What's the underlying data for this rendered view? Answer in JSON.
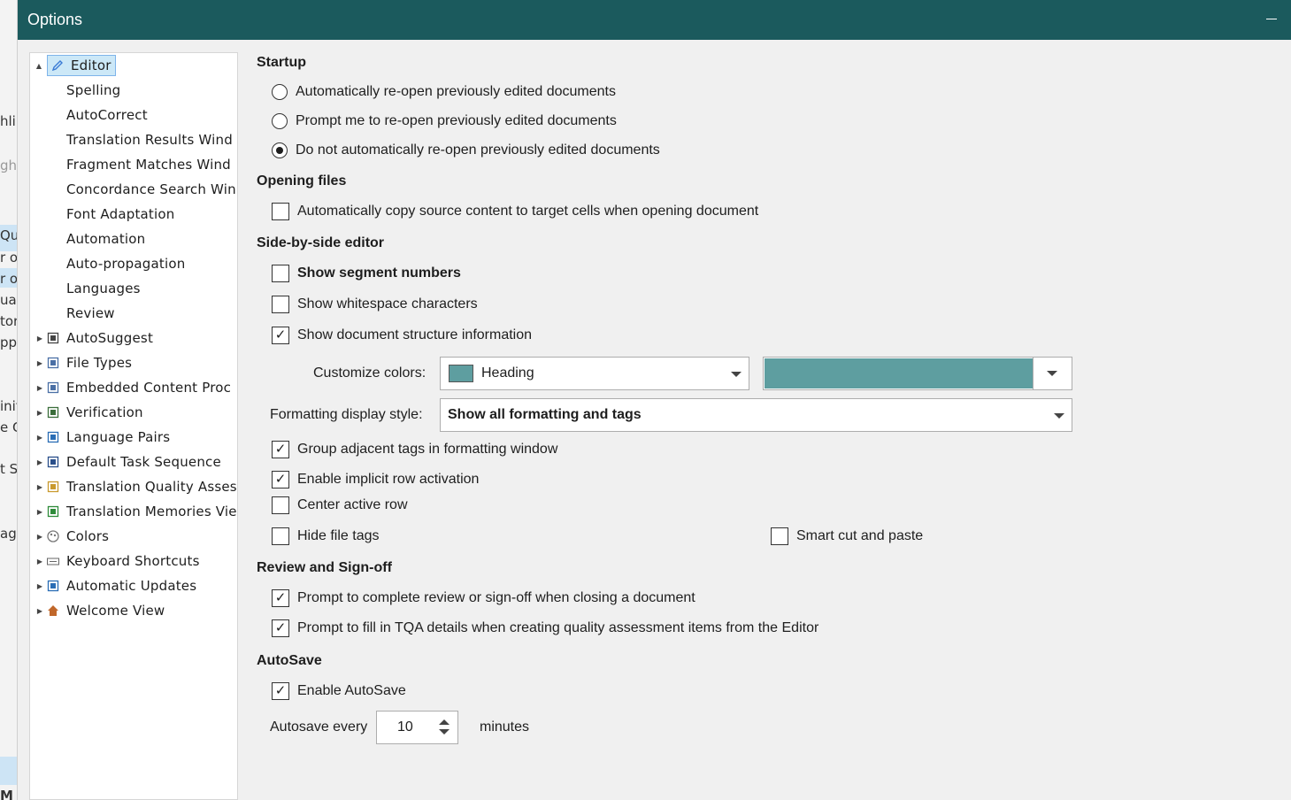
{
  "background_app": {
    "fragments": [
      "hli",
      "ghl",
      "Qu",
      "r o",
      "r o",
      "ual",
      "tor",
      "ppr",
      "init",
      "e C",
      "t S",
      "age",
      "M"
    ]
  },
  "window": {
    "title": "Options"
  },
  "tree": {
    "items": [
      {
        "label": "Editor",
        "icon": "pencil-icon",
        "expander": "▲",
        "selected": true,
        "top_level": true
      },
      {
        "label": "Spelling",
        "child": true
      },
      {
        "label": "AutoCorrect",
        "child": true
      },
      {
        "label": "Translation Results Wind",
        "child": true
      },
      {
        "label": "Fragment Matches Wind",
        "child": true
      },
      {
        "label": "Concordance Search Win",
        "child": true
      },
      {
        "label": "Font Adaptation",
        "child": true
      },
      {
        "label": "Automation",
        "child": true
      },
      {
        "label": "Auto-propagation",
        "child": true
      },
      {
        "label": "Languages",
        "child": true
      },
      {
        "label": "Review",
        "child": true
      },
      {
        "label": "AutoSuggest",
        "icon": "autosuggest-icon",
        "expander": "▶"
      },
      {
        "label": "File Types",
        "icon": "file-types-icon",
        "expander": "▶"
      },
      {
        "label": "Embedded Content Proc",
        "icon": "embedded-content-icon",
        "expander": "▶"
      },
      {
        "label": "Verification",
        "icon": "verification-icon",
        "expander": "▶"
      },
      {
        "label": "Language Pairs",
        "icon": "language-pairs-icon",
        "expander": "▶"
      },
      {
        "label": "Default Task Sequence",
        "icon": "task-sequence-icon",
        "expander": "▶"
      },
      {
        "label": "Translation Quality Asses",
        "icon": "tqa-icon",
        "expander": "▶"
      },
      {
        "label": "Translation Memories Vie",
        "icon": "translation-memories-icon",
        "expander": "▶"
      },
      {
        "label": "Colors",
        "icon": "palette-icon",
        "expander": "▶"
      },
      {
        "label": "Keyboard Shortcuts",
        "icon": "keyboard-icon",
        "expander": "▶"
      },
      {
        "label": "Automatic Updates",
        "icon": "updates-icon",
        "expander": "▶"
      },
      {
        "label": "Welcome View",
        "icon": "home-icon",
        "expander": "▶"
      }
    ]
  },
  "startup": {
    "heading": "Startup",
    "options": [
      {
        "label": "Automatically re-open previously edited documents",
        "selected": false
      },
      {
        "label": "Prompt me to re-open previously edited documents",
        "selected": false
      },
      {
        "label": "Do not automatically re-open previously edited documents",
        "selected": true
      }
    ]
  },
  "opening_files": {
    "heading": "Opening files",
    "auto_copy": {
      "label": "Automatically copy source content to target cells when opening document",
      "checked": false
    }
  },
  "side_by_side": {
    "heading": "Side-by-side editor",
    "show_segment_numbers": {
      "label": "Show segment numbers",
      "checked": false
    },
    "show_whitespace": {
      "label": "Show whitespace characters",
      "checked": false
    },
    "show_structure": {
      "label": "Show document structure information",
      "checked": true
    },
    "customize_colors_label": "Customize colors:",
    "customize_colors_value": "Heading",
    "swatch_color": "#5e9ea0",
    "formatting_style_label": "Formatting display style:",
    "formatting_style_value": "Show all formatting and tags",
    "group_tags": {
      "label": "Group adjacent tags in formatting window",
      "checked": true
    },
    "implicit_row": {
      "label": "Enable implicit row activation",
      "checked": true
    },
    "center_row": {
      "label": "Center active row",
      "checked": false
    },
    "hide_file_tags": {
      "label": "Hide file tags",
      "checked": false
    },
    "smart_cut": {
      "label": "Smart cut and paste",
      "checked": false
    }
  },
  "review": {
    "heading": "Review and Sign-off",
    "prompt_complete": {
      "label": "Prompt to complete review or sign-off when closing a document",
      "checked": true
    },
    "prompt_tqa": {
      "label": "Prompt to fill in TQA details when creating quality assessment items from the Editor",
      "checked": true
    }
  },
  "autosave": {
    "heading": "AutoSave",
    "enable": {
      "label": "Enable AutoSave",
      "checked": true
    },
    "every_label": "Autosave every",
    "value": "10",
    "unit": "minutes"
  },
  "check_mark": "✓"
}
